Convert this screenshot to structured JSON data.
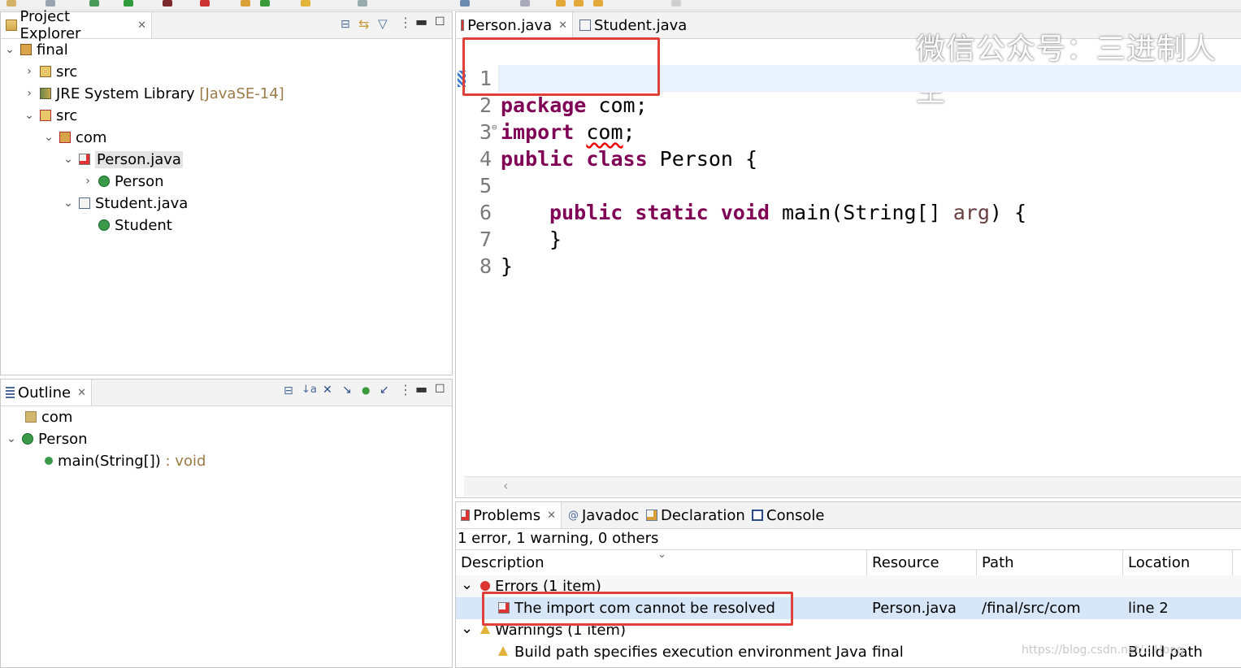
{
  "project_explorer": {
    "title": "Project Explorer",
    "tree": [
      {
        "label": "final",
        "extra": "",
        "depth": 0,
        "arrow": "v"
      },
      {
        "label": "src",
        "extra": "",
        "depth": 1,
        "arrow": ">"
      },
      {
        "label": "JRE System Library ",
        "extra": "[JavaSE-14]",
        "depth": 1,
        "arrow": ">"
      },
      {
        "label": "src",
        "extra": "",
        "depth": 1,
        "arrow": "v"
      },
      {
        "label": "com",
        "extra": "",
        "depth": 2,
        "arrow": "v"
      },
      {
        "label": "Person.java",
        "extra": "",
        "depth": 3,
        "arrow": "v"
      },
      {
        "label": "Person",
        "extra": "",
        "depth": 4,
        "arrow": ">"
      },
      {
        "label": "Student.java",
        "extra": "",
        "depth": 3,
        "arrow": "v"
      },
      {
        "label": "Student",
        "extra": "",
        "depth": 4,
        "arrow": ""
      }
    ]
  },
  "outline": {
    "title": "Outline",
    "items": [
      {
        "label": "com",
        "extra": ""
      },
      {
        "label": "Person",
        "extra": ""
      },
      {
        "label": "main(String[])",
        "extra": " : void"
      }
    ]
  },
  "editor": {
    "tabs": [
      {
        "label": "Person.java",
        "active": true
      },
      {
        "label": "Student.java",
        "active": false
      }
    ],
    "line_numbers": [
      "1",
      "2",
      "3",
      "4",
      "5",
      "6",
      "7",
      "8"
    ],
    "watermark": "微信公众号：三进制人生",
    "code": {
      "l1_kw": "package",
      "l1_rest": " com;",
      "l2_kw": "import",
      "l2_err": "com",
      "l2_rest": ";",
      "l3_kw": "public class",
      "l3_rest": " Person {",
      "l4_kw": "public static void",
      "l4_rest": " main(String[] ",
      "l4_param": "arg",
      "l4_end": ") {",
      "l6": "}",
      "l7": "}"
    }
  },
  "problems": {
    "tabs": [
      "Problems",
      "Javadoc",
      "Declaration",
      "Console"
    ],
    "summary": "1 error, 1 warning, 0 others",
    "columns": [
      "Description",
      "Resource",
      "Path",
      "Location"
    ],
    "rows": [
      {
        "type": "group",
        "label": "Errors (1 item)"
      },
      {
        "type": "item",
        "description": "The import com cannot be resolved",
        "resource": "Person.java",
        "path": "/final/src/com",
        "location": "line 2"
      },
      {
        "type": "group",
        "label": "Warnings (1 item)"
      },
      {
        "type": "item",
        "description": "Build path specifies execution environment JavaSE-",
        "resource": "final",
        "path": "",
        "location": "Build path"
      }
    ],
    "bottom_watermark": "https://blog.csdn.net/...Hong"
  },
  "colors": {
    "keyword": "#7f0055",
    "error": "#e0403a",
    "selection": "#d7e7f7"
  }
}
